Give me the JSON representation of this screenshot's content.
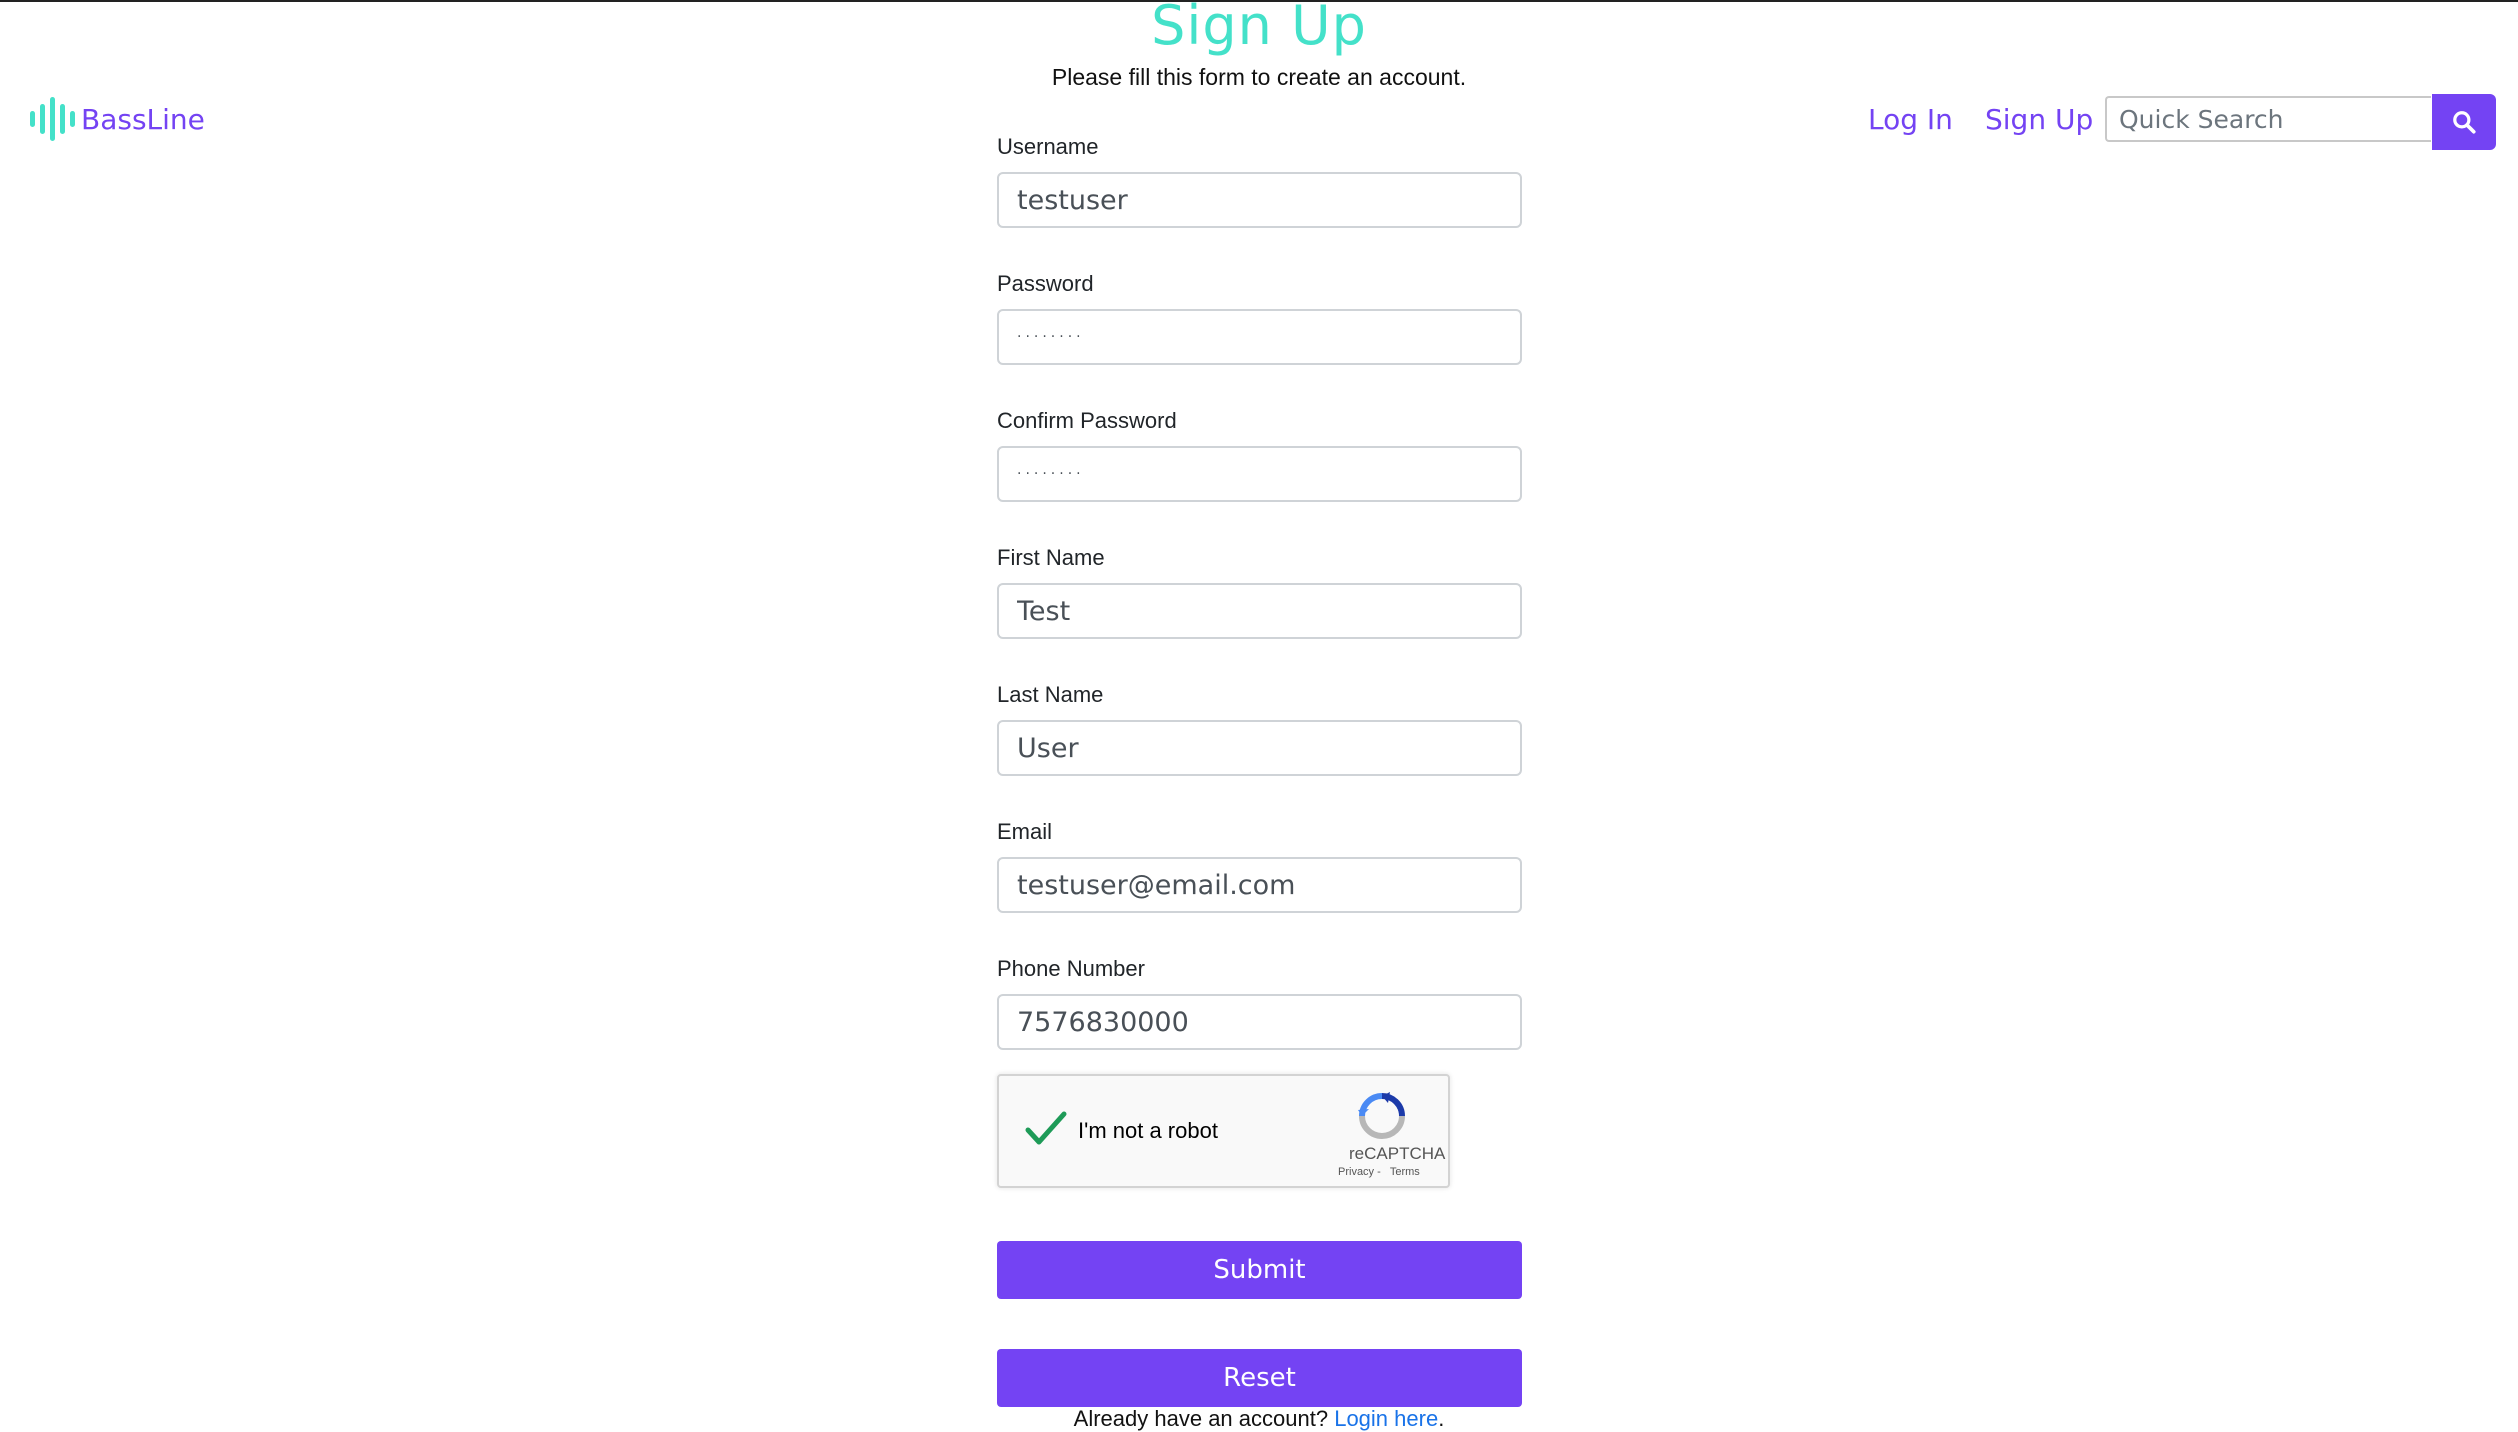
{
  "header": {
    "brand_name": "BassLine",
    "nav": {
      "login_label": "Log In",
      "signup_label": "Sign Up"
    },
    "search": {
      "placeholder": "Quick Search"
    }
  },
  "form": {
    "title": "Sign Up",
    "subtitle": "Please fill this form to create an account.",
    "fields": {
      "username": {
        "label": "Username",
        "value": "testuser"
      },
      "password": {
        "label": "Password",
        "value": "········"
      },
      "confirm_password": {
        "label": "Confirm Password",
        "value": "········"
      },
      "first_name": {
        "label": "First Name",
        "value": "Test"
      },
      "last_name": {
        "label": "Last Name",
        "value": "User"
      },
      "email": {
        "label": "Email",
        "value": "testuser@email.com"
      },
      "phone": {
        "label": "Phone Number",
        "value": "7576830000"
      }
    },
    "captcha": {
      "label": "I'm not a robot",
      "brand": "reCAPTCHA",
      "privacy": "Privacy",
      "terms": "Terms",
      "separator": " - "
    },
    "submit_label": "Submit",
    "reset_label": "Reset",
    "login_prompt": "Already have an account?",
    "login_link": "Login here",
    "login_suffix": "."
  },
  "colors": {
    "brand_purple": "#7443f3",
    "brand_teal": "#44e1c9",
    "link_blue": "#1a73e8"
  }
}
